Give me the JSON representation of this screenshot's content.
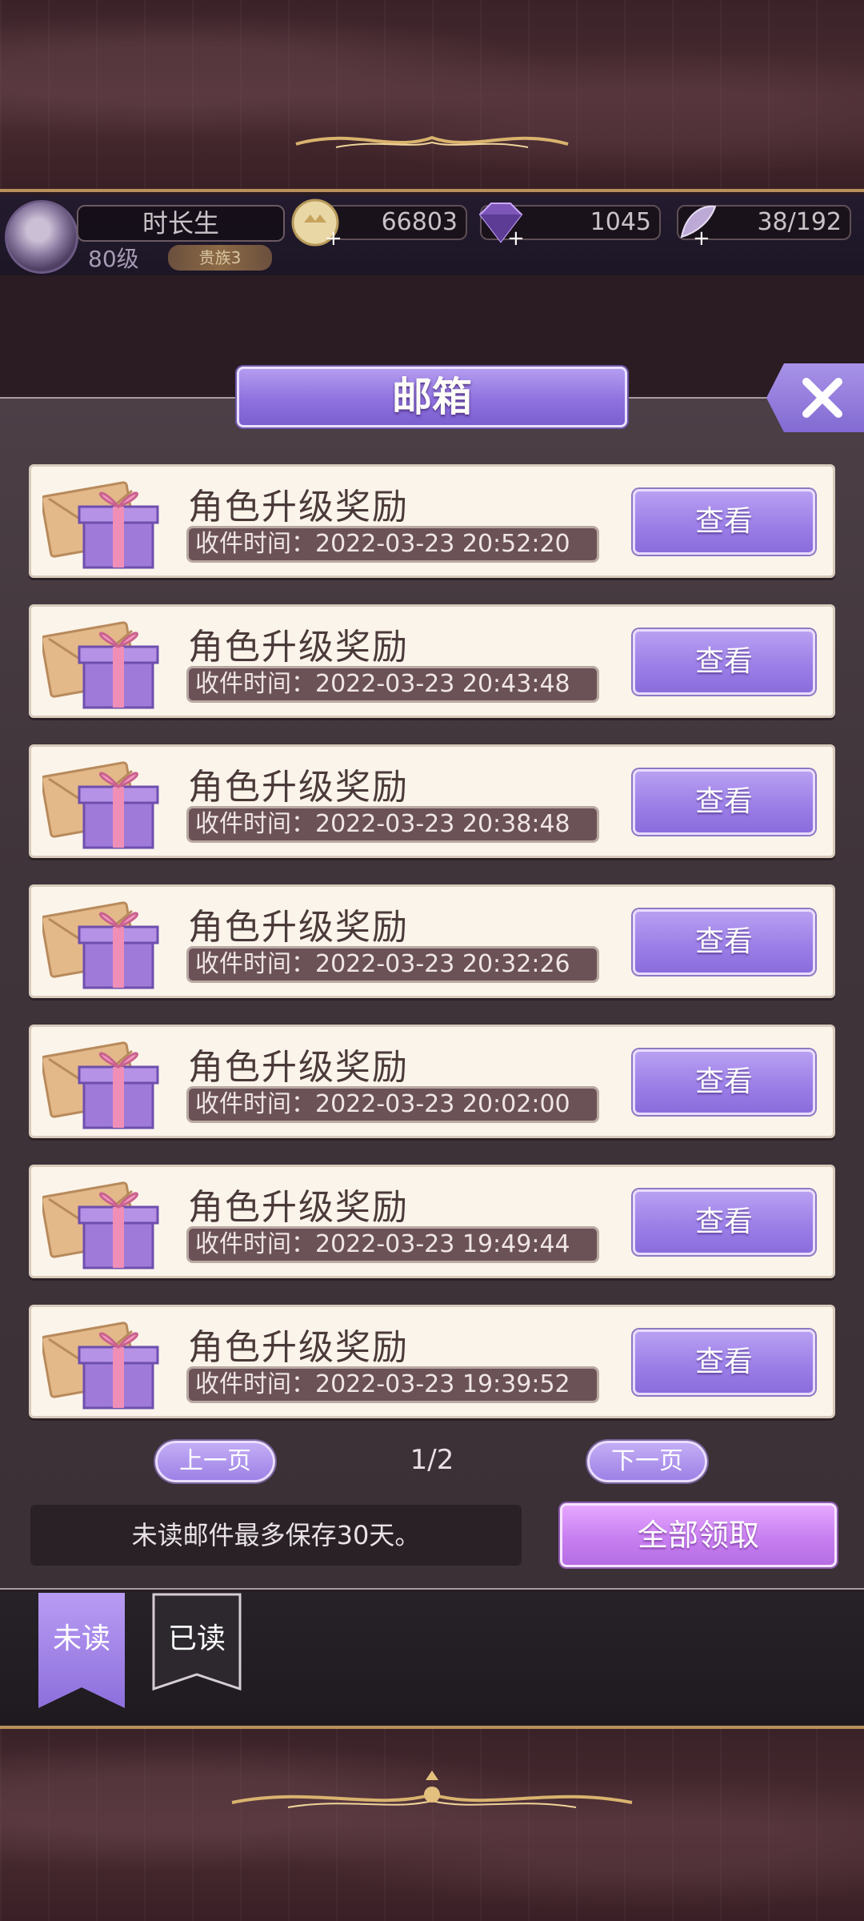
{
  "player": {
    "name": "时长生",
    "level": "80级",
    "rank": "贵族3",
    "gold": "66803",
    "gems": "1045",
    "stamina": "38/192"
  },
  "mailbox": {
    "title": "邮箱",
    "close_icon": "close-x-icon",
    "items": [
      {
        "title": "角色升级奖励",
        "time": "收件时间：2022-03-23 20:52:20",
        "button": "查看"
      },
      {
        "title": "角色升级奖励",
        "time": "收件时间：2022-03-23 20:43:48",
        "button": "查看"
      },
      {
        "title": "角色升级奖励",
        "time": "收件时间：2022-03-23 20:38:48",
        "button": "查看"
      },
      {
        "title": "角色升级奖励",
        "time": "收件时间：2022-03-23 20:32:26",
        "button": "查看"
      },
      {
        "title": "角色升级奖励",
        "time": "收件时间：2022-03-23 20:02:00",
        "button": "查看"
      },
      {
        "title": "角色升级奖励",
        "time": "收件时间：2022-03-23 19:49:44",
        "button": "查看"
      },
      {
        "title": "角色升级奖励",
        "time": "收件时间：2022-03-23 19:39:52",
        "button": "查看"
      }
    ],
    "prev_page": "上一页",
    "page_indicator": "1/2",
    "next_page": "下一页",
    "notice": "未读邮件最多保存30天。",
    "claim_all": "全部领取"
  },
  "tabs": {
    "unread": "未读",
    "read": "已读"
  },
  "colors": {
    "accent_purple": "#9a7de6",
    "claim_pink": "#c77ff0",
    "card_bg": "#fbf4ea",
    "panel_bg": "#3f343a"
  }
}
